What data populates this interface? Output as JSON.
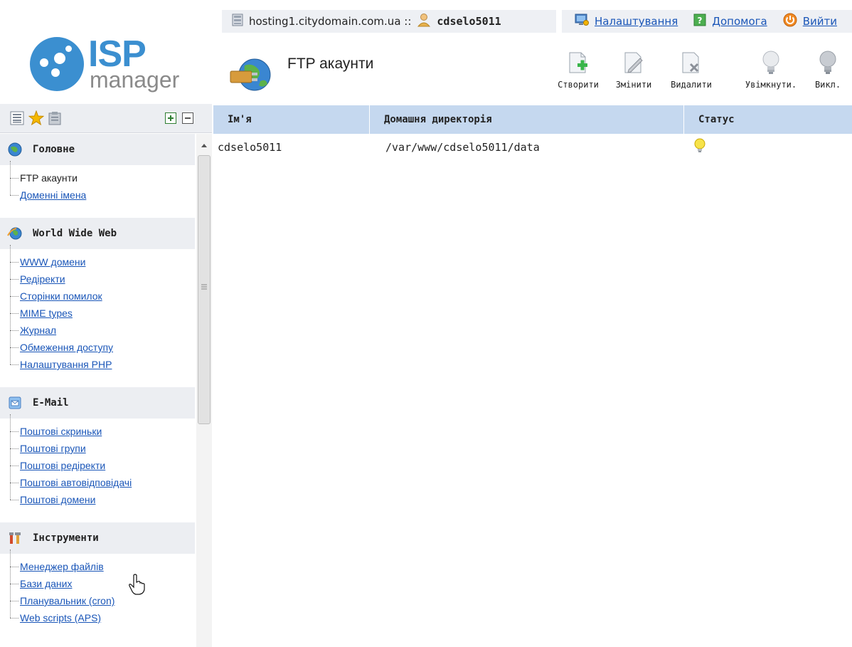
{
  "topbar": {
    "host": "hosting1.citydomain.com.ua ::",
    "user": "cdselo5011",
    "links": [
      {
        "label": "Налаштування",
        "icon": "settings-monitor-icon"
      },
      {
        "label": "Допомога",
        "icon": "help-icon"
      },
      {
        "label": "Вийти",
        "icon": "power-icon"
      }
    ]
  },
  "logo": {
    "isp": "ISP",
    "manager": "manager"
  },
  "page": {
    "title": "FTP акаунти",
    "icon": "globe-plug-icon"
  },
  "toolbar": [
    {
      "label": "Створити",
      "icon": "create-icon"
    },
    {
      "label": "Змінити",
      "icon": "edit-icon"
    },
    {
      "label": "Видалити",
      "icon": "delete-icon"
    },
    {
      "label": "Увімкнути.",
      "icon": "bulb-on-icon"
    },
    {
      "label": "Викл.",
      "icon": "bulb-off-icon"
    }
  ],
  "sidebar": {
    "sections": [
      {
        "title": "Головне",
        "icon": "globe-icon",
        "items": [
          {
            "label": "FTP акаунти",
            "active": true
          },
          {
            "label": "Доменні імена"
          }
        ]
      },
      {
        "title": "World Wide Web",
        "icon": "www-icon",
        "items": [
          {
            "label": "WWW домени"
          },
          {
            "label": "Редіректи"
          },
          {
            "label": "Сторінки помилок"
          },
          {
            "label": "MIME types"
          },
          {
            "label": "Журнал"
          },
          {
            "label": "Обмеження доступу"
          },
          {
            "label": "Налаштування PHP"
          }
        ]
      },
      {
        "title": "E-Mail",
        "icon": "mail-icon",
        "items": [
          {
            "label": "Поштові скриньки"
          },
          {
            "label": "Поштові групи"
          },
          {
            "label": "Поштові редіректи"
          },
          {
            "label": "Поштові автовідповідачі"
          },
          {
            "label": "Поштові домени"
          }
        ]
      },
      {
        "title": "Інструменти",
        "icon": "tools-icon",
        "items": [
          {
            "label": "Менеджер файлів"
          },
          {
            "label": "Бази даних"
          },
          {
            "label": "Планувальник (cron)"
          },
          {
            "label": "Web scripts (APS)"
          }
        ]
      }
    ]
  },
  "table": {
    "columns": [
      "Ім'я",
      "Домашня директорія",
      "Статус"
    ],
    "rows": [
      {
        "name": "cdselo5011",
        "home": "/var/www/cdselo5011/data",
        "status_icon": "bulb-on-icon"
      }
    ]
  },
  "colors": {
    "accent": "#3b8fd0",
    "link": "#1a56b8",
    "table_header": "#c5d8ef",
    "sidebar_header": "#eceef2"
  }
}
